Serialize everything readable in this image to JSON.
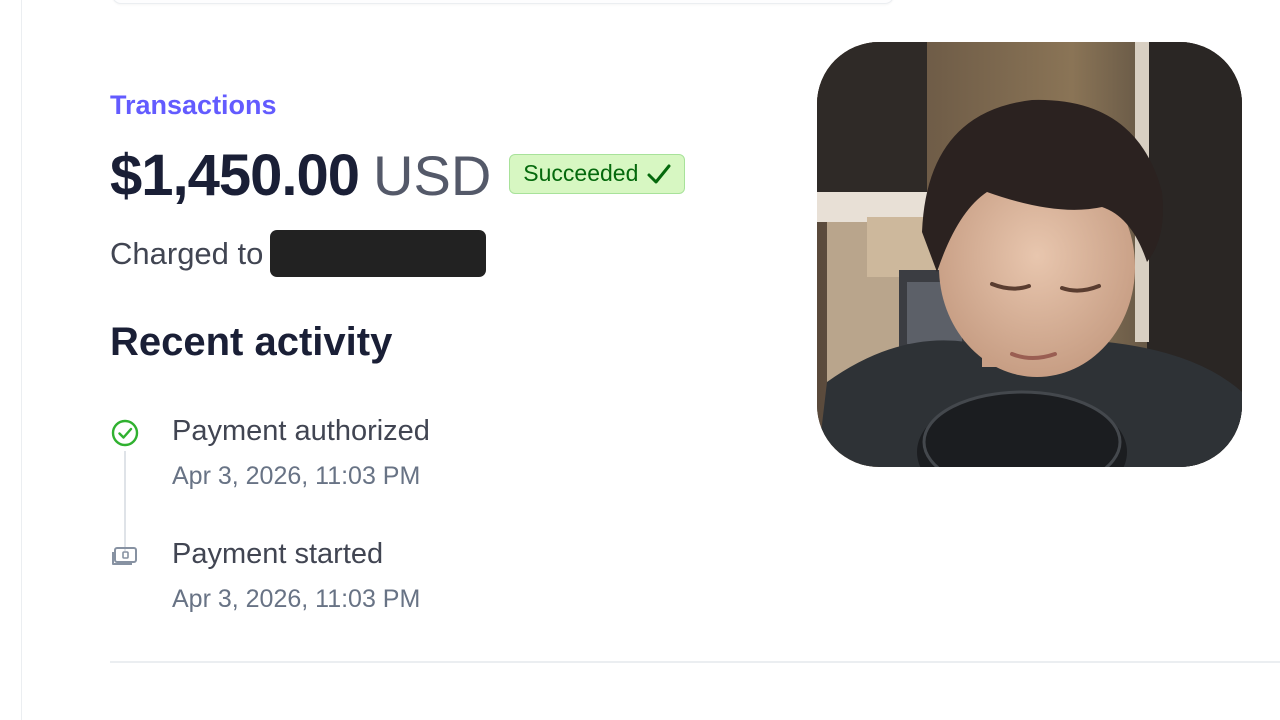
{
  "breadcrumb": {
    "label": "Transactions"
  },
  "payment": {
    "amount": "$1,450.00",
    "currency": "USD",
    "status": "Succeeded",
    "charged_to_label": "Charged to"
  },
  "recent_activity": {
    "title": "Recent activity",
    "events": [
      {
        "title": "Payment authorized",
        "time": "Apr 3, 2026, 11:03 PM",
        "icon": "check-circle-icon"
      },
      {
        "title": "Payment started",
        "time": "Apr 3, 2026, 11:03 PM",
        "icon": "payment-card-icon"
      }
    ]
  },
  "colors": {
    "accent": "#635bff",
    "success_text": "#05690d",
    "success_bg": "#d7f7c2",
    "success_border": "#a8e29a",
    "redaction": "#222222"
  }
}
